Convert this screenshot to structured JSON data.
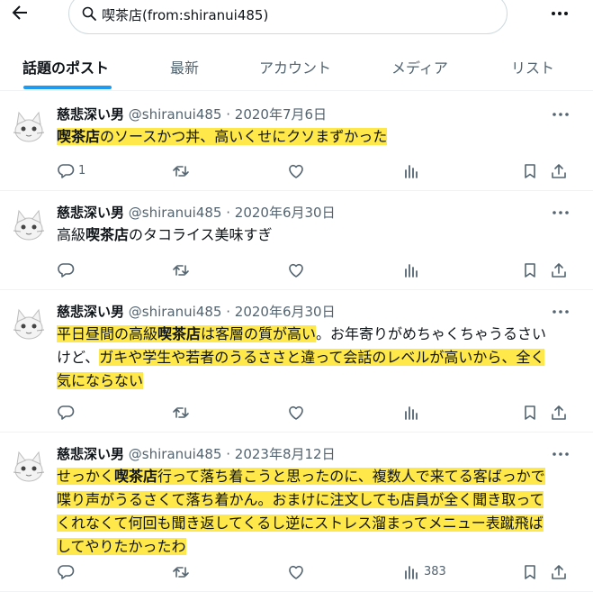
{
  "search": {
    "query": "喫茶店(from:shiranui485)"
  },
  "tabs": [
    "話題のポスト",
    "最新",
    "アカウント",
    "メディア",
    "リスト"
  ],
  "posts": [
    {
      "name": "慈悲深い男",
      "handle": "@shiranui485",
      "date": "2020年7月6日",
      "reply_count": "1",
      "views": "",
      "lines": [
        [
          {
            "t": "喫茶店",
            "kw": true,
            "hl": true
          },
          {
            "t": "のソースかつ丼、高いくせにクソまずかった",
            "hl": true
          }
        ]
      ]
    },
    {
      "name": "慈悲深い男",
      "handle": "@shiranui485",
      "date": "2020年6月30日",
      "reply_count": "",
      "views": "",
      "lines": [
        [
          {
            "t": "高級"
          },
          {
            "t": "喫茶店",
            "kw": true
          },
          {
            "t": "のタコライス美味すぎ"
          }
        ]
      ]
    },
    {
      "name": "慈悲深い男",
      "handle": "@shiranui485",
      "date": "2020年6月30日",
      "reply_count": "",
      "views": "",
      "lines": [
        [
          {
            "t": "平日昼間の高級",
            "hl": true
          },
          {
            "t": "喫茶店",
            "kw": true,
            "hl": true
          },
          {
            "t": "は客層の質が高い",
            "hl": true
          },
          {
            "t": "。お年寄りがめちゃくちゃうるさい"
          }
        ],
        [
          {
            "t": "けど、"
          },
          {
            "t": "ガキや学生や若者のうるささと違って会話のレベルが高いから、全く",
            "hl": true
          }
        ],
        [
          {
            "t": "気にならない",
            "hl": true
          }
        ]
      ]
    },
    {
      "name": "慈悲深い男",
      "handle": "@shiranui485",
      "date": "2023年8月12日",
      "reply_count": "",
      "views": "383",
      "lines": [
        [
          {
            "t": "せっかく",
            "hl": true
          },
          {
            "t": "喫茶店",
            "kw": true,
            "hl": true
          },
          {
            "t": "行って落ち着こうと思ったのに、複数人で来てる客ばっかで",
            "hl": true
          }
        ],
        [
          {
            "t": "喋り声がうるさくて落ち着かん。おまけに注文しても店員が全く聞き取って",
            "hl": true
          }
        ],
        [
          {
            "t": "くれなくて何回も聞き返してくるし逆にストレス溜まってメニュー表蹴飛ば",
            "hl": true
          }
        ],
        [
          {
            "t": "してやりたかったわ",
            "hl": true
          }
        ]
      ]
    }
  ]
}
